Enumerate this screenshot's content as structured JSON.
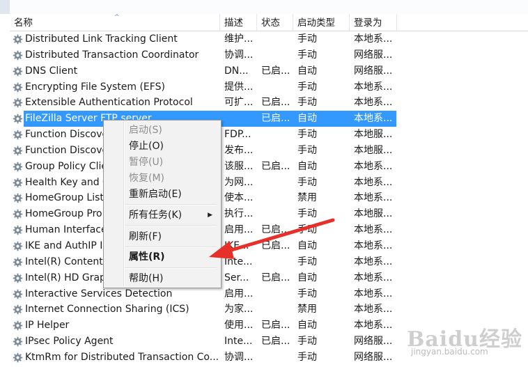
{
  "columns": [
    "名称",
    "描述",
    "状态",
    "启动类型",
    "登录为"
  ],
  "services": [
    {
      "name": "Distributed Link Tracking Client",
      "desc": "维护...",
      "status": "",
      "startup": "手动",
      "logon": "本地系..."
    },
    {
      "name": "Distributed Transaction Coordinator",
      "desc": "协调...",
      "status": "",
      "startup": "手动",
      "logon": "网络服..."
    },
    {
      "name": "DNS Client",
      "desc": "DN...",
      "status": "已启...",
      "startup": "自动",
      "logon": "网络服..."
    },
    {
      "name": "Encrypting File System (EFS)",
      "desc": "提供...",
      "status": "",
      "startup": "手动",
      "logon": "本地系..."
    },
    {
      "name": "Extensible Authentication Protocol",
      "desc": "可扩...",
      "status": "已启...",
      "startup": "手动",
      "logon": "本地系..."
    },
    {
      "name": "FileZilla Server FTP server",
      "desc": "",
      "status": "已启...",
      "startup": "自动",
      "logon": "本地系..."
    },
    {
      "name": "Function Discove",
      "desc": "FDP...",
      "status": "",
      "startup": "手动",
      "logon": "本地服..."
    },
    {
      "name": "Function Discove",
      "desc": "发布...",
      "status": "",
      "startup": "手动",
      "logon": "本地服..."
    },
    {
      "name": "Group Policy Clie",
      "desc": "该服...",
      "status": "已启...",
      "startup": "自动",
      "logon": "本地系..."
    },
    {
      "name": "Health Key and C",
      "desc": "为网...",
      "status": "",
      "startup": "手动",
      "logon": "本地系..."
    },
    {
      "name": "HomeGroup List",
      "desc": "使本...",
      "status": "",
      "startup": "禁用",
      "logon": "本地系..."
    },
    {
      "name": "HomeGroup Pro",
      "desc": "执行...",
      "status": "",
      "startup": "手动",
      "logon": "本地服..."
    },
    {
      "name": "Human Interface",
      "desc": "启用...",
      "status": "已启...",
      "startup": "手动",
      "logon": "本地系..."
    },
    {
      "name": "IKE and AuthIP IP",
      "desc": "IKE...",
      "status": "已启...",
      "startup": "自动",
      "logon": "本地系..."
    },
    {
      "name": "Intel(R) Content",
      "desc": "Inte...",
      "status": "",
      "startup": "手动",
      "logon": "本地系..."
    },
    {
      "name": "Intel(R) HD Grap",
      "desc": "Ser...",
      "status": "已启...",
      "startup": "自动",
      "logon": "本地系..."
    },
    {
      "name": "Interactive Services Detection",
      "desc": "启用...",
      "status": "",
      "startup": "手动",
      "logon": "本地系..."
    },
    {
      "name": "Internet Connection Sharing (ICS)",
      "desc": "为家...",
      "status": "",
      "startup": "禁用",
      "logon": "本地系..."
    },
    {
      "name": "IP Helper",
      "desc": "使用...",
      "status": "已启...",
      "startup": "自动",
      "logon": "本地系..."
    },
    {
      "name": "IPsec Policy Agent",
      "desc": "Inte...",
      "status": "已启...",
      "startup": "手动",
      "logon": "网络服..."
    },
    {
      "name": "KtmRm for Distributed Transaction Co...",
      "desc": "协调...",
      "status": "",
      "startup": "手动",
      "logon": "网络服..."
    }
  ],
  "selected_index": 5,
  "context_menu": {
    "items": [
      {
        "label": "启动(S)",
        "disabled": true
      },
      {
        "label": "停止(O)",
        "disabled": false
      },
      {
        "label": "暂停(U)",
        "disabled": true
      },
      {
        "label": "恢复(M)",
        "disabled": true
      },
      {
        "label": "重新启动(E)",
        "disabled": false
      },
      {
        "label": "所有任务(K)",
        "disabled": false,
        "submenu": true
      },
      {
        "label": "刷新(F)",
        "disabled": false
      },
      {
        "label": "属性(R)",
        "disabled": false,
        "bold": true
      },
      {
        "label": "帮助(H)",
        "disabled": false
      }
    ],
    "submenu_glyph": "▶"
  },
  "sort_glyph": "^",
  "watermark": {
    "text": "Baidu经验",
    "url": "jingyan.baidu.com"
  },
  "colors": {
    "selection": "#3399ff",
    "annotation_arrow": "#e8302a",
    "gear": "#7a8a99"
  }
}
